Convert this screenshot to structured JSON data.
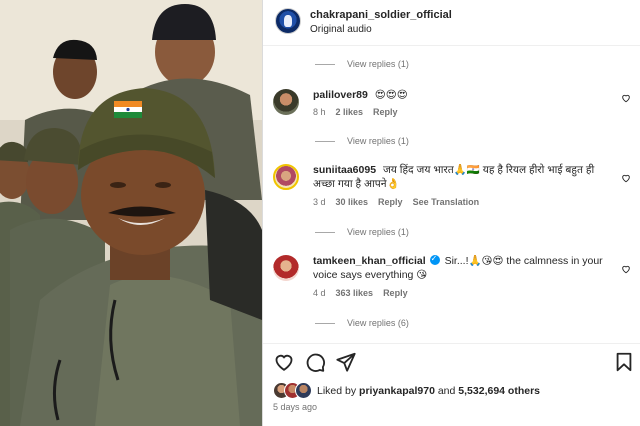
{
  "post": {
    "username": "chakrapani_soldier_official",
    "audio": "Original audio",
    "more_label": "•••"
  },
  "comments": [
    {
      "view_replies_above": "View replies (1)",
      "username": "palilover89",
      "text": "😍😍😍",
      "time": "8 h",
      "likes": "2 likes",
      "reply": "Reply",
      "translate": ""
    },
    {
      "view_replies_above": "View replies (1)",
      "username": "suniitaa6095",
      "text": "जय हिंद जय भारत🙏🇮🇳 यह है रियल हीरो भाई बहुत ही अच्छा गया है आपने👌",
      "time": "3 d",
      "likes": "30 likes",
      "reply": "Reply",
      "translate": "See Translation"
    },
    {
      "view_replies_above": "View replies (1)",
      "username": "tamkeen_khan_official",
      "text": "Sir...!🙏😘😍 the calmness in your voice says everything 😘",
      "time": "4 d",
      "likes": "363 likes",
      "reply": "Reply",
      "translate": ""
    }
  ],
  "final_view_replies": "View replies (6)",
  "likes": {
    "prefix": "Liked by",
    "user": "priyankapal970",
    "middle": "and",
    "count": "5,532,694 others"
  },
  "date": "5 days ago",
  "icons": [
    "heart-icon",
    "comment-icon",
    "share-icon",
    "bookmark-icon"
  ]
}
